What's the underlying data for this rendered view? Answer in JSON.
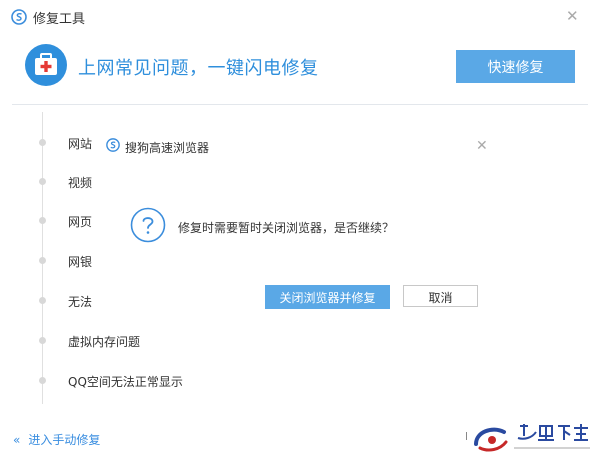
{
  "window": {
    "title": "修复工具",
    "close_icon": "close-icon"
  },
  "header": {
    "headline": "上网常见问题，一键闪电修复",
    "quick_button": "快速修复",
    "icon": "medical-kit-icon"
  },
  "colors": {
    "accent": "#5aa8e6",
    "headline": "#2f8fdc",
    "kit_red": "#e53935"
  },
  "list": [
    "网站",
    "视频",
    "网页",
    "网银",
    "无法",
    "虚拟内存问题",
    "QQ空间无法正常显示"
  ],
  "dialog": {
    "title": "搜狗高速浏览器",
    "message": "修复时需要暂时关闭浏览器，是否继续？",
    "confirm_button": "关闭浏览器并修复",
    "cancel_button": "取消",
    "icon": "question-icon"
  },
  "footer": {
    "manual_link": "进入手动修复",
    "chevron": "«"
  }
}
